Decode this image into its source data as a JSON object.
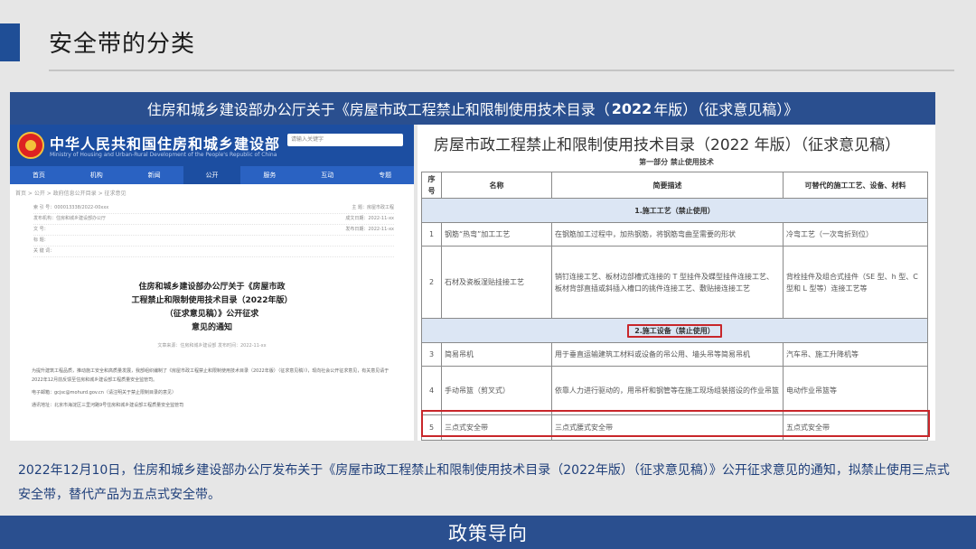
{
  "slide": {
    "title": "安全带的分类",
    "banner": {
      "prefix": "住房和城乡建设部办公厅关于《房屋市政工程禁止和限制使用技术目录（",
      "bold": "2022",
      "suffix": "年版）（征求意见稿）》"
    },
    "caption": "2022年12月10日，住房和城乡建设部办公厅发布关于《房屋市政工程禁止和限制使用技术目录（2022年版）（征求意见稿）》公开征求意见的通知，拟禁止使用三点式安全带，替代产品为五点式安全带。",
    "footer": "政策导向"
  },
  "left_screenshot": {
    "site_name": "中华人民共和国住房和城乡建设部",
    "site_sub": "Ministry of Housing and Urban-Rural Development of the People's Republic of China",
    "search_placeholder": "请输入关键字",
    "nav": [
      "首页",
      "机构",
      "新闻",
      "公开",
      "服务",
      "互动",
      "专题"
    ],
    "breadcrumb": "首页 > 公开 > 政府信息公开目录 > 征求意见",
    "meta": [
      [
        "索 引 号：000013338/2022-00xxx",
        "主 题：房屋市政工程"
      ],
      [
        "发布机构：住房和城乡建设部办公厅",
        "成文日期：2022-11-xx"
      ],
      [
        "文 号：",
        "发布日期：2022-11-xx"
      ],
      [
        "标 题：",
        ""
      ],
      [
        "关 键 词：",
        ""
      ]
    ],
    "doc_title_lines": [
      "住房和城乡建设部办公厅关于《房屋市政",
      "工程禁止和限制使用技术目录（2022年版）",
      "（征求意见稿）》公开征求",
      "意见的通知"
    ],
    "doc_info": "文章来源：住房和城乡建设部  发布时间：2022-11-xx",
    "doc_body": [
      "为提升建筑工程品质，推动施工安全和高质量发展，我部组织编制了《房屋市政工程禁止和限制使用技术目录（2022年版）（征求意见稿）》，现向社会公开征求意见，有关意见请于2022年12月前反馈至住房和城乡建设部工程质量安全监管司。",
      "电子邮箱：gcjsc@mohurd.gov.cn（请注明关于禁止限制目录的意见）",
      "通讯地址：北京市海淀区三里河路9号住房和城乡建设部工程质量安全监管司"
    ]
  },
  "right_screenshot": {
    "title": "房屋市政工程禁止和限制使用技术目录（2022 年版）（征求意见稿）",
    "part": "第一部分  禁止使用技术",
    "columns": [
      "序号",
      "名称",
      "简要描述",
      "可替代的施工工艺、设备、材料"
    ],
    "sections": [
      {
        "label": "1.施工工艺（禁止使用）",
        "rows": [
          [
            "1",
            "钢筋“热弯”加工工艺",
            "在钢筋加工过程中，加热钢筋，将钢筋弯曲至需要的形状",
            "冷弯工艺（一次弯折到位）"
          ],
          [
            "2",
            "石材及瓷板湿贴挂接工艺",
            "销钉连接工艺、板材边部槽式连接的 T 型挂件及蝶型挂件连接工艺、板材背部直插或斜插入槽口的挑件连接工艺、敷贴接连接工艺",
            "背栓挂件及组合式挂件（SE 型、h 型、C 型和 L 型等）连接工艺等"
          ]
        ]
      },
      {
        "label": "2.施工设备（禁止使用）",
        "rows": [
          [
            "3",
            "简易吊机",
            "用于垂直运输建筑工材料或设备的吊公用、墙头吊等简易吊机",
            "汽车吊、施工升降机等"
          ],
          [
            "4",
            "手动吊篮（剪叉式）",
            "依靠人力进行驱动的，用吊杆和钢管等在施工现场组装搭设的作业吊篮",
            "电动作业吊篮等"
          ],
          [
            "5",
            "三点式安全带",
            "三点式腰式安全带",
            "五点式安全带"
          ]
        ]
      }
    ]
  },
  "colors": {
    "brand_blue": "#2a4f8f",
    "highlight_red": "#c8262a",
    "section_fill": "#dce6f4"
  }
}
